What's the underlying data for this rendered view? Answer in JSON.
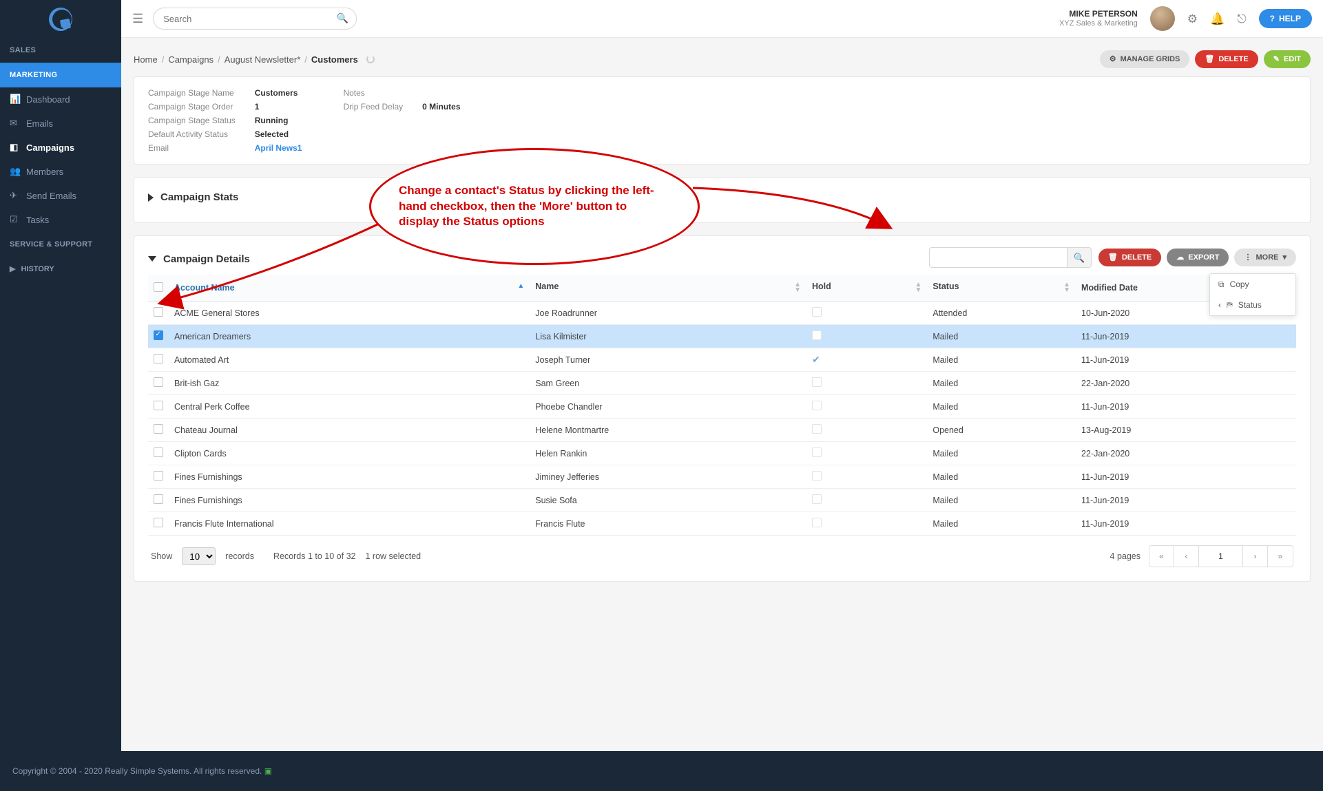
{
  "sidebar": {
    "sections": [
      {
        "title": "SALES",
        "active": false
      },
      {
        "title": "MARKETING",
        "active": true
      },
      {
        "title": "SERVICE & SUPPORT",
        "active": false
      }
    ],
    "items": [
      {
        "label": "Dashboard",
        "icon": "dashboard-icon"
      },
      {
        "label": "Emails",
        "icon": "envelope-icon"
      },
      {
        "label": "Campaigns",
        "icon": "bullhorn-icon",
        "active": true
      },
      {
        "label": "Members",
        "icon": "users-icon"
      },
      {
        "label": "Send Emails",
        "icon": "send-icon"
      },
      {
        "label": "Tasks",
        "icon": "check-icon"
      }
    ],
    "history": "HISTORY"
  },
  "topbar": {
    "search_placeholder": "Search",
    "user_name": "MIKE PETERSON",
    "user_org": "XYZ Sales & Marketing",
    "help_label": "HELP"
  },
  "breadcrumb": {
    "items": [
      "Home",
      "Campaigns",
      "August Newsletter*"
    ],
    "current": "Customers"
  },
  "page_actions": {
    "manage_grids": "MANAGE GRIDS",
    "delete": "DELETE",
    "edit": "EDIT"
  },
  "summary": {
    "left": [
      {
        "lbl": "Campaign Stage Name",
        "val": "Customers"
      },
      {
        "lbl": "Campaign Stage Order",
        "val": "1"
      },
      {
        "lbl": "Campaign Stage Status",
        "val": "Running"
      },
      {
        "lbl": "Default Activity Status",
        "val": "Selected"
      },
      {
        "lbl": "Email",
        "val": "April News1",
        "link": true
      }
    ],
    "right": [
      {
        "lbl": "Notes",
        "val": ""
      },
      {
        "lbl": "Drip Feed Delay",
        "val": "0 Minutes"
      }
    ]
  },
  "stats_title": "Campaign Stats",
  "details_title": "Campaign Details",
  "details_toolbar": {
    "delete": "DELETE",
    "export": "EXPORT",
    "more": "MORE"
  },
  "more_menu": {
    "copy": "Copy",
    "status": "Status"
  },
  "columns": [
    "Account Name",
    "Name",
    "Hold",
    "Status",
    "Modified Date"
  ],
  "rows": [
    {
      "account": "ACME General Stores",
      "name": "Joe Roadrunner",
      "hold": false,
      "status": "Attended",
      "modified": "10-Jun-2020",
      "selected": false
    },
    {
      "account": "American Dreamers",
      "name": "Lisa Kilmister",
      "hold": false,
      "status": "Mailed",
      "modified": "11-Jun-2019",
      "selected": true
    },
    {
      "account": "Automated Art",
      "name": "Joseph Turner",
      "hold": true,
      "status": "Mailed",
      "modified": "11-Jun-2019",
      "selected": false
    },
    {
      "account": "Brit-ish Gaz",
      "name": "Sam Green",
      "hold": false,
      "status": "Mailed",
      "modified": "22-Jan-2020",
      "selected": false
    },
    {
      "account": "Central Perk Coffee",
      "name": "Phoebe Chandler",
      "hold": false,
      "status": "Mailed",
      "modified": "11-Jun-2019",
      "selected": false
    },
    {
      "account": "Chateau Journal",
      "name": "Helene Montmartre",
      "hold": false,
      "status": "Opened",
      "modified": "13-Aug-2019",
      "selected": false
    },
    {
      "account": "Clipton Cards",
      "name": "Helen Rankin",
      "hold": false,
      "status": "Mailed",
      "modified": "22-Jan-2020",
      "selected": false
    },
    {
      "account": "Fines Furnishings",
      "name": "Jiminey Jefferies",
      "hold": false,
      "status": "Mailed",
      "modified": "11-Jun-2019",
      "selected": false
    },
    {
      "account": "Fines Furnishings",
      "name": "Susie Sofa",
      "hold": false,
      "status": "Mailed",
      "modified": "11-Jun-2019",
      "selected": false
    },
    {
      "account": "Francis Flute International",
      "name": "Francis Flute",
      "hold": false,
      "status": "Mailed",
      "modified": "11-Jun-2019",
      "selected": false
    }
  ],
  "footer_table": {
    "show": "Show",
    "records": "records",
    "page_size": "10",
    "summary": "Records 1 to 10 of 32",
    "selection": "1 row selected",
    "pages": "4 pages",
    "current_page": "1"
  },
  "annotation": {
    "text": "Change a contact's Status by clicking the left-hand checkbox, then the 'More' button to display the Status options"
  },
  "footer": "Copyright © 2004 - 2020 Really Simple Systems. All rights reserved."
}
